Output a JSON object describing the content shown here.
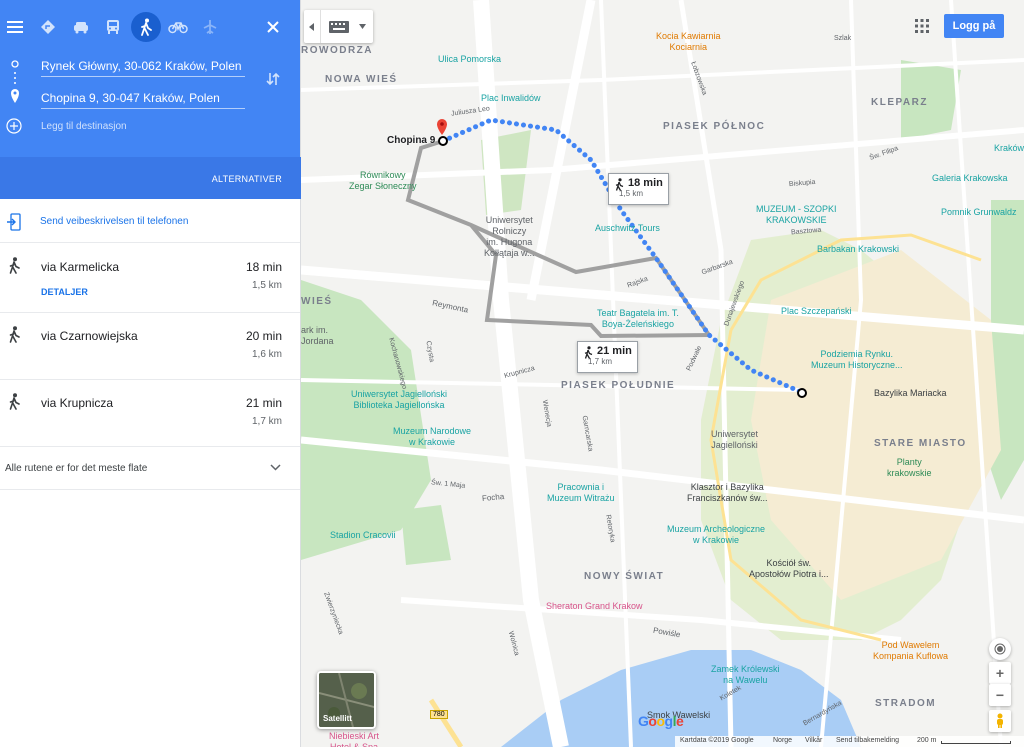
{
  "panel": {
    "origin_value": "Rynek Główny, 30-062 Kraków, Polen",
    "destination_value": "Chopina 9, 30-047 Kraków, Polen",
    "add_destination_placeholder": "Legg til destinasjon",
    "alternatives_label": "ALTERNATIVER",
    "send_to_phone_label": "Send veibeskrivelsen til telefonen",
    "routes": [
      {
        "name": "via Karmelicka",
        "time": "18 min",
        "distance": "1,5 km",
        "details": "DETALJER"
      },
      {
        "name": "via Czarnowiejska",
        "time": "20 min",
        "distance": "1,6 km"
      },
      {
        "name": "via Krupnicza",
        "time": "21 min",
        "distance": "1,7 km"
      }
    ],
    "flat_note": "Alle rutene er for det meste flate",
    "mode_icons": [
      "best-route-icon",
      "car-icon",
      "transit-icon",
      "walking-icon",
      "bicycle-icon",
      "flight-icon"
    ]
  },
  "map": {
    "districts": [
      "ROWODRZA",
      "NOWA WIEŚ",
      "KLEPARZ",
      "PIASEK PÓŁNOC",
      "PIASEK POŁUDNIE",
      "STARE MIASTO",
      "NOWY ŚWIAT",
      "STRADOM",
      "WIEŚ"
    ],
    "pois": {
      "kawiarnia": "Kocia Kawiarnia\nKociarnia",
      "ulica_pomorska": "Ulica Pomorska",
      "plac_inwalidow": "Plac Inwalidów",
      "zegar": "Równikowy\nZegar Słoneczny",
      "uniwersytet_rolniczy": "Uniwersytet\nRolniczy\nim. Hugona\nKołłątaja w...",
      "auschwitz_tours": "Auschwitz Tours",
      "teatr": "Teatr Bagatela im. T.\nBoya-Żeleńskiego",
      "muzeum_szopki": "MUZEUM - SZOPKI\nKRAKOWSKIE",
      "galeria": "Galeria Krakowska",
      "pomnik": "Pomnik Grunwaldz",
      "krakow": "Kraków",
      "barbakan": "Barbakan Krakowski",
      "plac_szczepanski": "Plac Szczepański",
      "podziemia": "Podziemia Rynku.\nMuzeum Historyczne...",
      "bazylika": "Bazylika Mariacka",
      "biblioteka": "Uniwersytet Jagielloński\nBiblioteka Jagiellońska",
      "muzeum_narodowe": "Muzeum Narodowe\nw Krakowie",
      "uj": "Uniwersytet\nJagielloński",
      "planty": "Planty\nkrakowskie",
      "park": "ark im.\nJordana",
      "pracownia": "Pracownia i\nMuzeum Witrażu",
      "klasztor": "Klasztor i Bazylika\nFranciszkanów św...",
      "stadion": "Stadion Cracovii",
      "muzeum_archeo": "Muzeum Archeologiczne\nw Krakowie",
      "kosciol": "Kościół św.\nApostołów Piotra i...",
      "sheraton": "Sheraton Grand Krakow",
      "pod_wawelem": "Pod Wawelem\nKompania Kuflowa",
      "zamek": "Zamek Królewski\nna Wawelu",
      "smok": "Smok Wawelski",
      "niebieski": "Niebieski Art\nHotel & Spa",
      "road_780": "780"
    },
    "streets": {
      "reymonta": "Reymonta",
      "focha": "Focha",
      "juliusza_leo": "Juliusza Leo",
      "rajska": "Rajska",
      "garbarska": "Garbarska",
      "krupnicza": "Krupnicza",
      "powisle": "Powiśle",
      "basztowa": "Basztowa",
      "biskupia": "Biskupia",
      "szlak": "Szlak",
      "sw_filipa": "Św. Filipa",
      "podwale": "Podwale",
      "wenecja": "Wenecja",
      "garncarska": "Garncarska",
      "retoryka": "Retoryka",
      "dunajewskiego": "Dunajewskiego",
      "bernardynska": "Bernardyńska",
      "koletek": "Koletek",
      "zwierzyniecka": "Zwierzyniecka",
      "lobzowska": "Łobzowska",
      "czysta": "Czysta",
      "kochanowskiego": "Kochanowskiego",
      "sw_1_maja": "Św. 1 Maja",
      "wolnica": "Wolnica"
    },
    "marker_label": "Chopina 9",
    "callout_selected": {
      "time": "18 min",
      "distance": "1,5 km"
    },
    "callout_alt": {
      "time": "21 min",
      "distance": "1,7 km"
    },
    "satellite_label": "Satellitt",
    "login_label": "Logg på",
    "google_logo": "Google",
    "footer": {
      "map_data": "Kartdata ©2019 Google",
      "country": "Norge",
      "terms": "Vilkår",
      "feedback": "Send tilbakemelding",
      "scale": "200 m"
    },
    "colors": {
      "route_selected": "#4285f4",
      "route_alt": "#a0a0a0",
      "park": "#c8e6c0",
      "water": "#a9cdf5",
      "panel_header": "#4285f4"
    }
  }
}
